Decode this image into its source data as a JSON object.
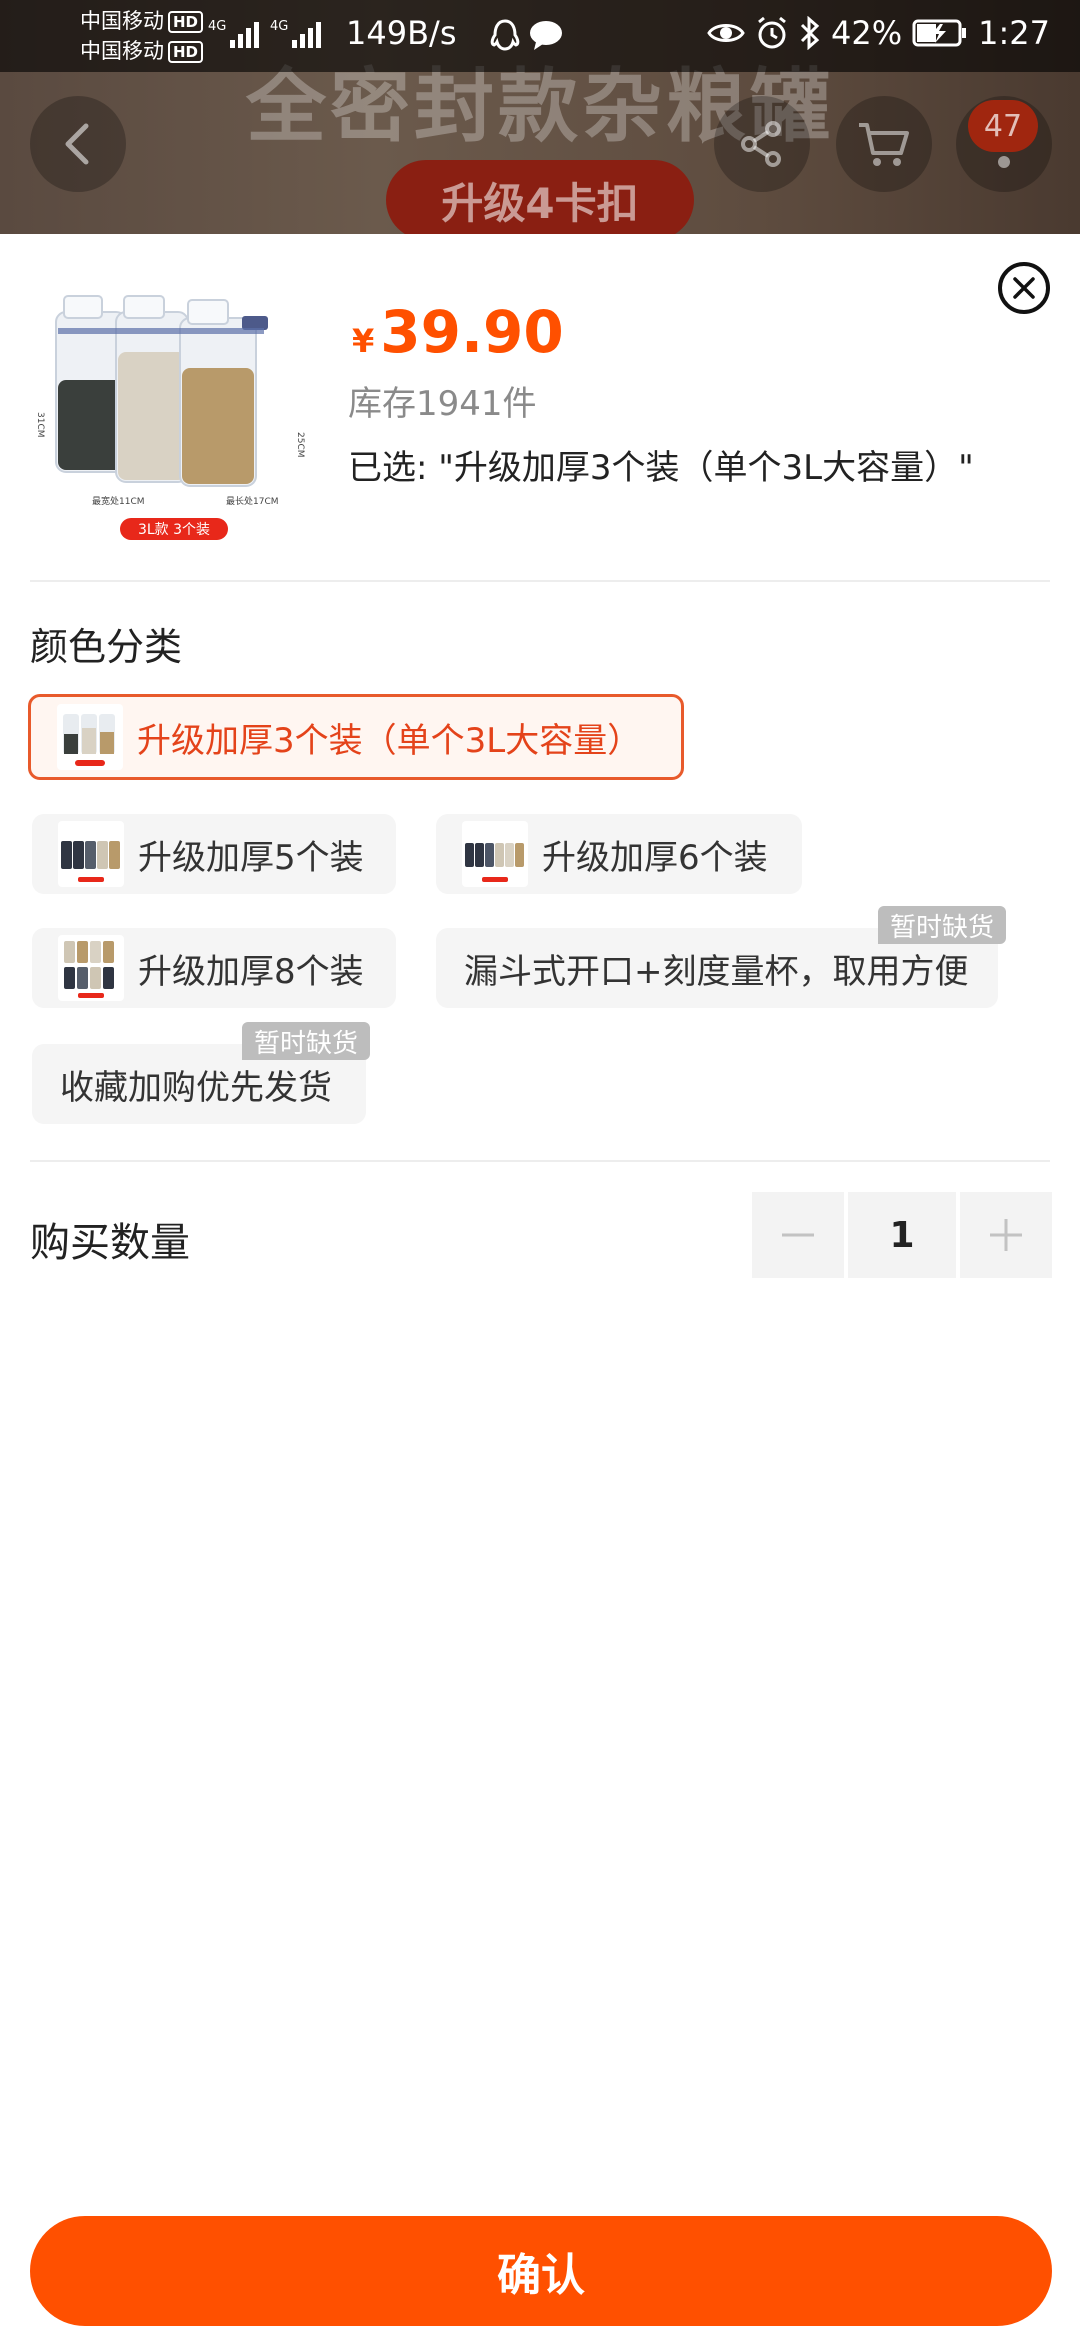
{
  "status_bar": {
    "carrier_1": "中国移动",
    "carrier_2": "中国移动",
    "hd_label": "HD",
    "net_tag": "4G",
    "net_speed": "149B/s",
    "battery": "42%",
    "time": "1:27"
  },
  "background": {
    "title": "全密封款杂粮罐",
    "pill": "升级4卡扣",
    "cart_badge": "47"
  },
  "product": {
    "price_symbol": "¥",
    "price": "39.90",
    "stock": "库存1941件",
    "selected": "已选: \"升级加厚3个装（单个3L大容量）\"",
    "thumb_tag": "3L款 3个装",
    "thumb_dim_height": "31CM",
    "thumb_dim_height2": "25CM",
    "thumb_dim_width": "最宽处11CM",
    "thumb_dim_length": "最长处17CM"
  },
  "color_section": {
    "title": "颜色分类",
    "options": [
      {
        "label": "升级加厚3个装（单个3L大容量）",
        "selected": true
      },
      {
        "label": "升级加厚5个装",
        "selected": false
      },
      {
        "label": "升级加厚6个装",
        "selected": false
      },
      {
        "label": "升级加厚8个装",
        "selected": false
      },
      {
        "label": "漏斗式开口+刻度量杯，取用方便",
        "selected": false,
        "tag": "暂时缺货"
      },
      {
        "label": "收藏加购优先发货",
        "selected": false,
        "tag": "暂时缺货"
      }
    ]
  },
  "quantity": {
    "label": "购买数量",
    "value": "1"
  },
  "confirm_label": "确认",
  "colors": {
    "accent": "#ff5000",
    "selected_border": "#e85a2b",
    "out_of_stock_tag": "#bdbdbd"
  }
}
